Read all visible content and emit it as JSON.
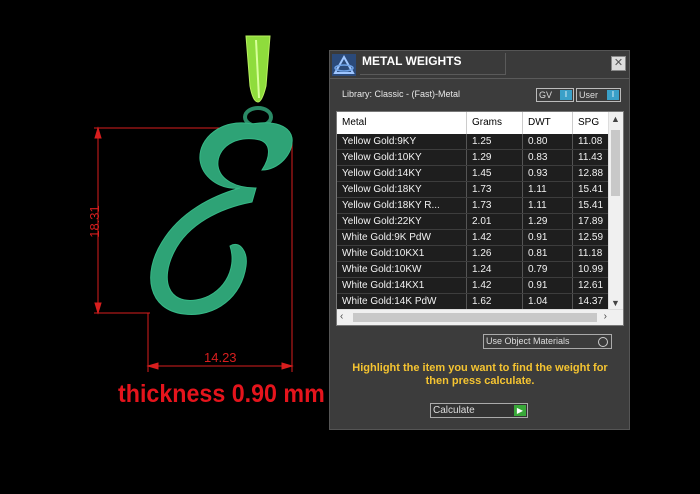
{
  "scene": {
    "dim_height": "18.31",
    "dim_width": "14.23",
    "thickness_label": "thickness 0.90 mm",
    "pendant_color": "#2ea376",
    "bail_color": "#8fdc3c",
    "dimension_color": "#d81e1e"
  },
  "panel": {
    "title": "METAL WEIGHTS",
    "close_icon": "close-icon",
    "library_label": "Library: Classic - (Fast)-Metal",
    "gv_label": "GV",
    "user_label": "User",
    "columns": [
      "Metal",
      "Grams",
      "DWT",
      "SPG"
    ],
    "rows": [
      [
        "Yellow Gold:9KY",
        "1.25",
        "0.80",
        "11.08"
      ],
      [
        "Yellow Gold:10KY",
        "1.29",
        "0.83",
        "11.43"
      ],
      [
        "Yellow Gold:14KY",
        "1.45",
        "0.93",
        "12.88"
      ],
      [
        "Yellow Gold:18KY",
        "1.73",
        "1.11",
        "15.41"
      ],
      [
        "Yellow Gold:18KY R...",
        "1.73",
        "1.11",
        "15.41"
      ],
      [
        "Yellow Gold:22KY",
        "2.01",
        "1.29",
        "17.89"
      ],
      [
        "White Gold:9K PdW",
        "1.42",
        "0.91",
        "12.59"
      ],
      [
        "White Gold:10KX1",
        "1.26",
        "0.81",
        "11.18"
      ],
      [
        "White Gold:10KW",
        "1.24",
        "0.79",
        "10.99"
      ],
      [
        "White Gold:14KX1",
        "1.42",
        "0.91",
        "12.61"
      ],
      [
        "White Gold:14K PdW",
        "1.62",
        "1.04",
        "14.37"
      ]
    ],
    "use_object_materials": "Use Object Materials",
    "hint": "Highlight the item you want to find the weight for then press calculate.",
    "calculate_label": "Calculate",
    "accent_color": "#f5c431"
  }
}
